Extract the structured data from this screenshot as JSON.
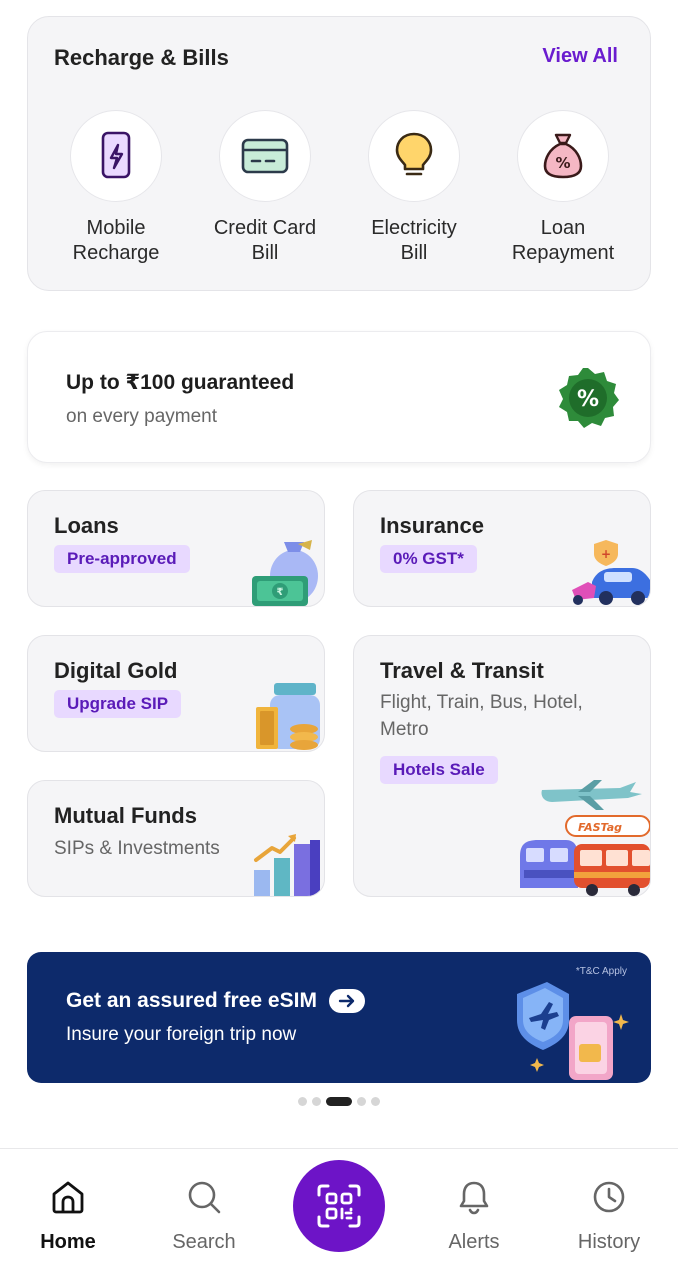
{
  "recharge_bills": {
    "title": "Recharge & Bills",
    "view_all": "View All",
    "items": [
      {
        "line1": "Mobile",
        "line2": "Recharge",
        "icon": "mobile-phone-icon"
      },
      {
        "line1": "Credit Card",
        "line2": "Bill",
        "icon": "credit-card-icon"
      },
      {
        "line1": "Electricity",
        "line2": "Bill",
        "icon": "light-bulb-icon"
      },
      {
        "line1": "Loan",
        "line2": "Repayment",
        "icon": "money-bag-percent-icon"
      }
    ]
  },
  "cashback": {
    "title": "Up to ₹100 guaranteed",
    "subtitle": "on every payment",
    "badge_symbol": "%"
  },
  "tiles": {
    "loans": {
      "title": "Loans",
      "chip": "Pre-approved"
    },
    "insurance": {
      "title": "Insurance",
      "chip": "0% GST*"
    },
    "digital_gold": {
      "title": "Digital Gold",
      "chip": "Upgrade SIP"
    },
    "travel": {
      "title": "Travel & Transit",
      "sub_line1": "Flight, Train, Bus, Hotel,",
      "sub_line2": "Metro",
      "chip": "Hotels Sale",
      "fastag": "FASTag"
    },
    "mutual_funds": {
      "title": "Mutual Funds",
      "subtitle": "SIPs & Investments"
    }
  },
  "esim_banner": {
    "tc": "*T&C Apply",
    "title": "Get an assured free eSIM",
    "subtitle": "Insure your foreign trip now"
  },
  "carousel": {
    "count": 5,
    "active_index": 2
  },
  "bottom_nav": {
    "home": "Home",
    "search": "Search",
    "alerts": "Alerts",
    "history": "History",
    "active": "home"
  },
  "colors": {
    "brand_purple": "#6d14c7",
    "chip_bg": "#e8d9ff",
    "banner_navy": "#0d2a6b",
    "badge_green": "#2e8b3a"
  }
}
